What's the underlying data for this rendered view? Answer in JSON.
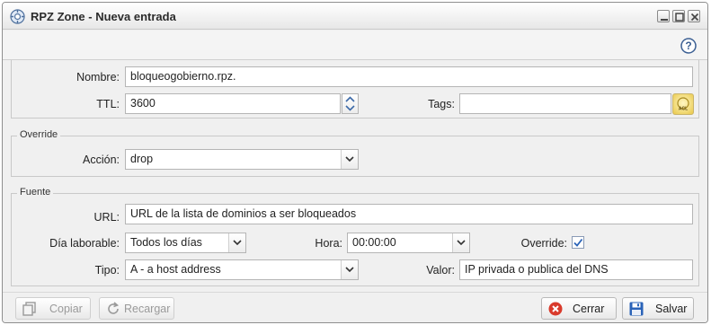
{
  "window": {
    "title": "RPZ Zone - Nueva entrada",
    "icon": "gear-globe-icon"
  },
  "toolbar": {
    "help_icon": "help-icon"
  },
  "form": {
    "nombre": {
      "label": "Nombre:",
      "value": "bloqueogobierno.rpz."
    },
    "ttl": {
      "label": "TTL:",
      "value": "3600"
    },
    "tags": {
      "label": "Tags:",
      "value": "",
      "button_icon": "acl-tag-icon"
    },
    "override_section": {
      "legend": "Override",
      "accion": {
        "label": "Acción:",
        "value": "drop"
      }
    },
    "fuente_section": {
      "legend": "Fuente",
      "url": {
        "label": "URL:",
        "value": "URL de la lista de dominios a ser bloqueados"
      },
      "dia_laborable": {
        "label": "Día laborable:",
        "value": "Todos los días"
      },
      "hora": {
        "label": "Hora:",
        "value": "00:00:00"
      },
      "override": {
        "label": "Override:",
        "checked": true
      },
      "tipo": {
        "label": "Tipo:",
        "value": "A - a host address"
      },
      "valor": {
        "label": "Valor:",
        "value": "IP privada o publica del DNS"
      }
    }
  },
  "footer": {
    "copiar": "Copiar",
    "recargar": "Recargar",
    "cerrar": "Cerrar",
    "salvar": "Salvar"
  },
  "colors": {
    "accent": "#2a63b8",
    "close_red": "#d93a2b"
  }
}
